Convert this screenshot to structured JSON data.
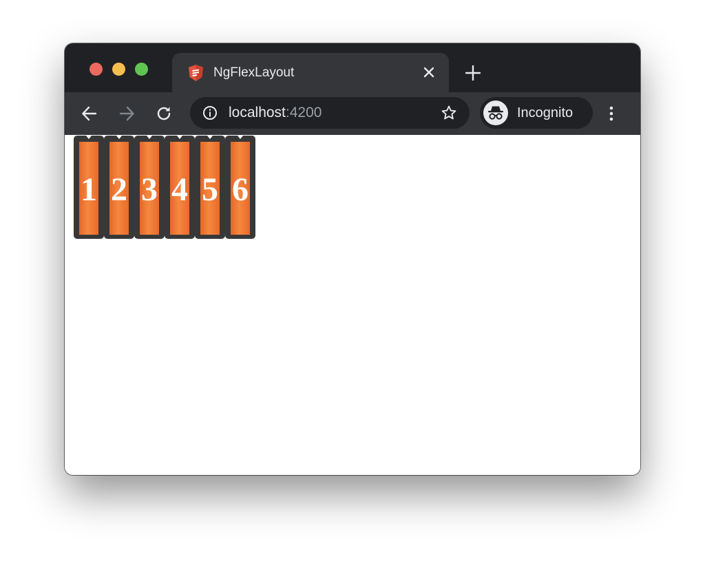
{
  "window": {
    "traffic_lights": [
      "close",
      "minimize",
      "zoom"
    ]
  },
  "tab": {
    "favicon": "angular-flex-logo-icon",
    "title": "NgFlexLayout",
    "close_icon": "close-icon"
  },
  "toolbar": {
    "back_icon": "arrow-left-icon",
    "forward_icon": "arrow-right-icon",
    "reload_icon": "reload-icon",
    "info_icon": "info-icon",
    "url_host": "localhost",
    "url_port": ":4200",
    "bookmark_icon": "star-icon",
    "profile_label": "Incognito",
    "profile_icon": "incognito-icon",
    "menu_icon": "kebab-menu-icon"
  },
  "flex_items": [
    {
      "label": "1"
    },
    {
      "label": "2"
    },
    {
      "label": "3"
    },
    {
      "label": "4"
    },
    {
      "label": "5"
    },
    {
      "label": "6"
    }
  ],
  "colors": {
    "tabstrip_bg": "#202124",
    "toolbar_bg": "#35363a",
    "box_frame": "#383838",
    "box_fill": "#f5883f",
    "text_light": "#e8eaed",
    "text_dim": "#9aa0a6"
  }
}
